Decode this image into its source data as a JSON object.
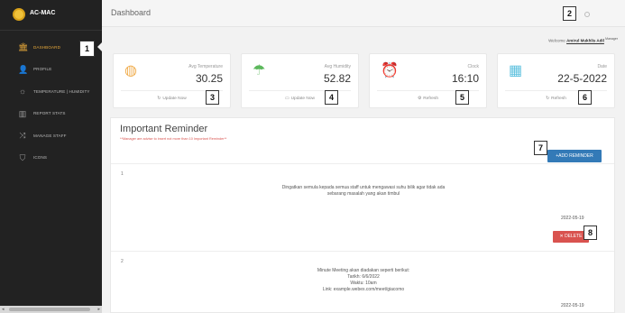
{
  "app": {
    "name": "AC-MAC"
  },
  "sidebar": {
    "items": [
      {
        "label": "DASHBOARD",
        "icon": "bank-icon",
        "glyph": "🏛"
      },
      {
        "label": "PROFILE",
        "icon": "user-icon",
        "glyph": "👤"
      },
      {
        "label": "TEMPERATURE | HUMIDITY",
        "icon": "sun-icon",
        "glyph": "☼"
      },
      {
        "label": "REPORT STATS",
        "icon": "bar-chart-icon",
        "glyph": "▥"
      },
      {
        "label": "MANAGE STAFF",
        "icon": "shuffle-icon",
        "glyph": "⤨"
      },
      {
        "label": "ICONS",
        "icon": "shield-icon",
        "glyph": "⛉"
      }
    ]
  },
  "topbar": {
    "title": "Dashboard"
  },
  "welcome": {
    "prefix": "Welcome",
    "name": "Amirul Mukhlis Adil",
    "role": "Manager"
  },
  "cards": [
    {
      "label": "Avg Temperature",
      "value": "30.25",
      "action": "Update Now",
      "icon": "basketball-icon",
      "glyph": "◍",
      "color": "#f0ad4e",
      "action_icon": "↻"
    },
    {
      "label": "Avg Humidity",
      "value": "52.82",
      "action": "Update Now",
      "icon": "umbrella-icon",
      "glyph": "☂",
      "color": "#5cb85c",
      "action_icon": "▭"
    },
    {
      "label": "Clock",
      "value": "16:10",
      "action": "Refresh",
      "icon": "alarm-clock-icon",
      "glyph": "⏰",
      "color": "#d9534f",
      "action_icon": "⚙"
    },
    {
      "label": "Date",
      "value": "22-5-2022",
      "action": "Refresh",
      "icon": "calendar-icon",
      "glyph": "▦",
      "color": "#5bc0de",
      "action_icon": "↻"
    }
  ],
  "reminder": {
    "title": "Important Reminder",
    "note": "**Manager are advise to insert not more than 10 Important Reminder**",
    "add_label": "+ADD REMINDER",
    "delete_label": "✕ DELETE",
    "items": [
      {
        "num": "1",
        "lines": [
          "Dingatkan semula kepada semua staff untuk mengawasi suhu bilik agar tidak ada",
          "sebarang masalah yang akan timbul"
        ],
        "date": "2022-05-19"
      },
      {
        "num": "2",
        "lines": [
          "Minute Meeting akan diadakan seperti berikut:",
          "Tarikh: 6/6/2022",
          "Waktu: 10am",
          "Link: example.webex.com/meet/giacomo"
        ],
        "date": "2022-05-19"
      }
    ]
  },
  "callouts": [
    "1",
    "2",
    "3",
    "4",
    "5",
    "6",
    "7",
    "8"
  ],
  "colors": {
    "sidebar_bg": "#222222",
    "accent": "#e8a93a",
    "primary_btn": "#337ab7",
    "danger_btn": "#d9534f"
  }
}
